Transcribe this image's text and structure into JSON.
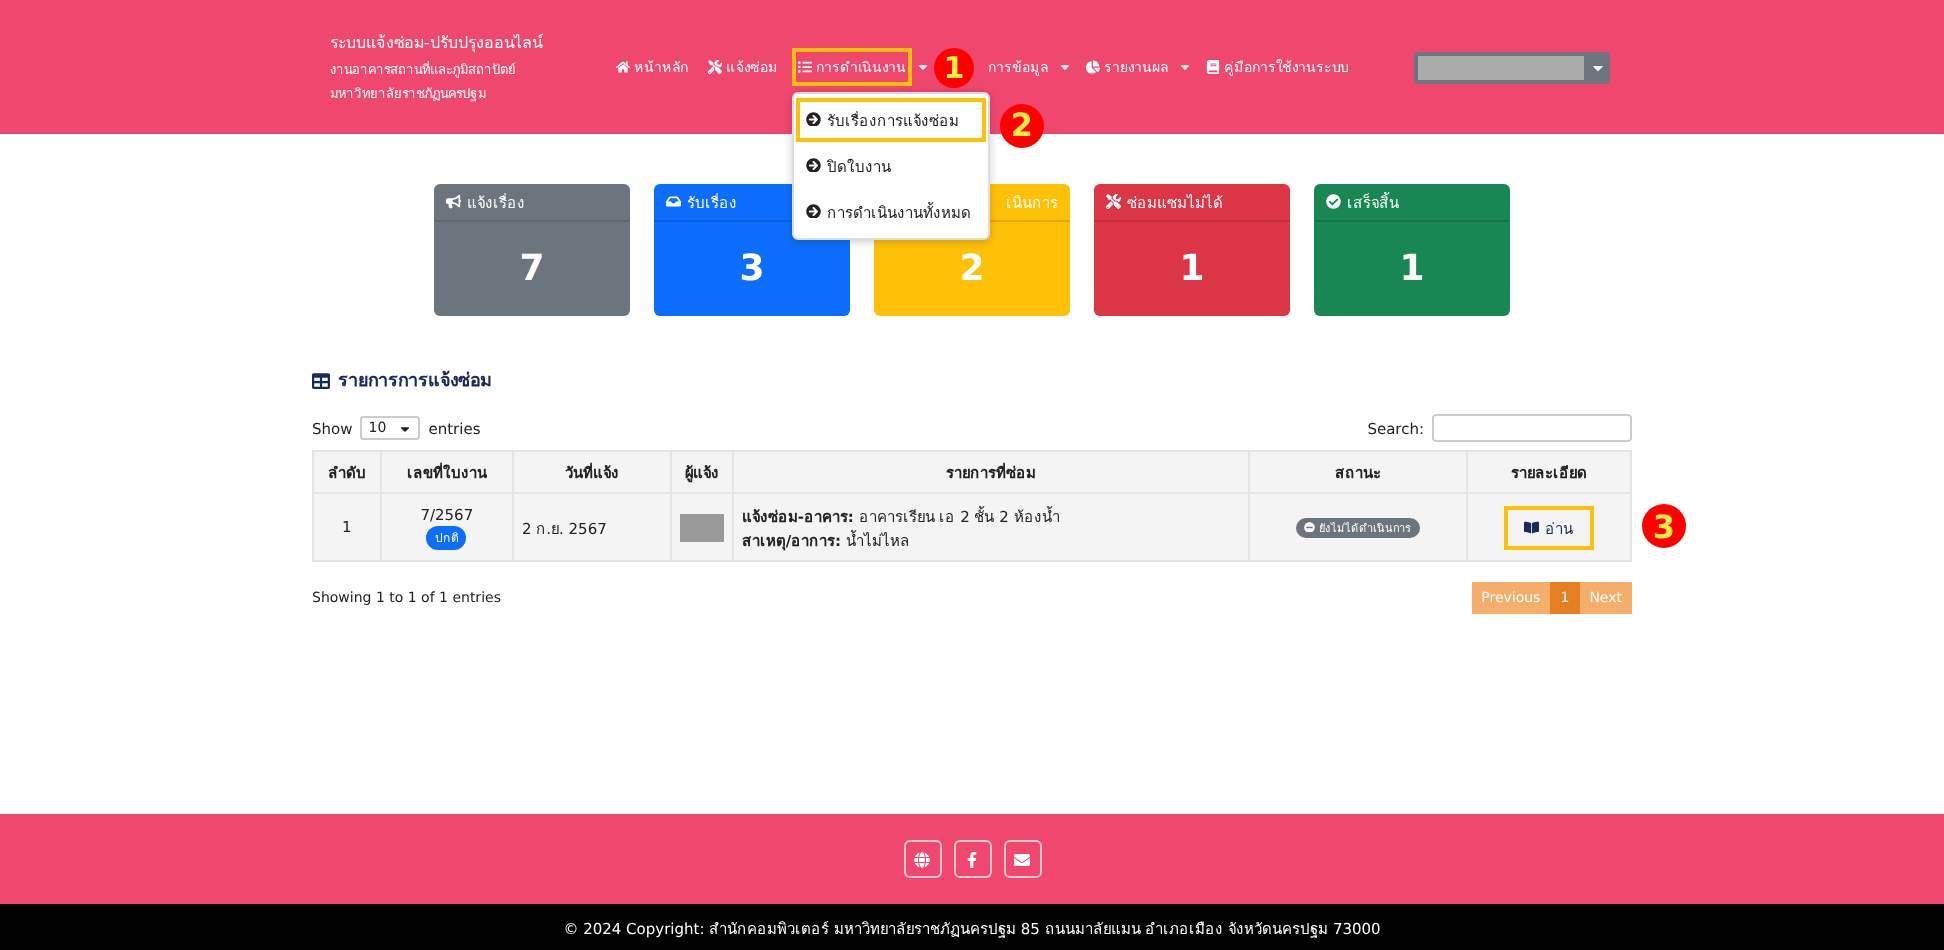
{
  "brand": {
    "title": "ระบบแจ้งซ่อม-ปรับปรุงออนไลน์",
    "subtitle_lines": [
      "งานอาคารสถานที่และภูมิสถาปัตย์",
      "มหาวิทยาลัยราชภัฏนครปฐม"
    ]
  },
  "nav": [
    {
      "label": "หน้าหลัก",
      "caret": false,
      "highlighted": false
    },
    {
      "label": "แจ้งซ่อม",
      "caret": false,
      "highlighted": false
    },
    {
      "label": "การดำเนินงาน",
      "caret": true,
      "highlighted": true
    },
    {
      "label": "การข้อมูล",
      "caret": true,
      "highlighted": false
    },
    {
      "label": "รายงานผล",
      "caret": true,
      "highlighted": false
    },
    {
      "label": "คู่มือการใช้งานระบบ",
      "caret": false,
      "highlighted": false
    }
  ],
  "dropdown": [
    {
      "label": "รับเรื่องการแจ้งซ่อม",
      "highlighted": true
    },
    {
      "label": "ปิดใบงาน",
      "highlighted": false
    },
    {
      "label": "การดำเนินงานทั้งหมด",
      "highlighted": false
    }
  ],
  "markers": [
    "1",
    "2",
    "3"
  ],
  "cards": [
    {
      "title": "แจ้งเรื่อง",
      "count": "7",
      "color": "#6c757d"
    },
    {
      "title": "รับเรื่อง",
      "count": "3",
      "color": "#0d6efd"
    },
    {
      "title": "เนินการ",
      "count": "2",
      "color": "#ffc107"
    },
    {
      "title": "ซ่อมแซมไม่ได้",
      "count": "1",
      "color": "#dc3545"
    },
    {
      "title": "เสร็จสิ้น",
      "count": "1",
      "color": "#198754"
    }
  ],
  "table_section": {
    "title": "รายการการแจ้งซ่อม",
    "show_label": "Show",
    "page_size": "10",
    "entries_label": "entries",
    "search_label": "Search:",
    "columns": [
      "ลำดับ",
      "เลขที่ใบงาน",
      "วันที่แจ้ง",
      "ผู้แจ้ง",
      "รายการที่ซ่อม",
      "สถานะ",
      "รายละเอียด"
    ],
    "rows": [
      {
        "no": "1",
        "job_no": "7/2567",
        "priority": "ปกติ",
        "date": "2 ก.ย. 2567",
        "item": "**แจ้งซ่อม-อาคาร:** อาคารเรียน เอ 2 ชั้น 2 ห้องน้ำ",
        "cause": "**สาเหตุ/อาการ:** น้ำไม่ไหล",
        "status": "ยังไม่ได้ดำเนินการ",
        "action": "อ่าน",
        "action_highlighted": true
      }
    ],
    "info": "Showing 1 to 1 of 1 entries",
    "pagination": [
      {
        "label": "Previous",
        "selected": false
      },
      {
        "label": "1",
        "selected": true
      },
      {
        "label": "Next",
        "selected": false
      }
    ]
  },
  "footer": {
    "copyright": "© 2024 Copyright: สำนักคอมพิวเตอร์ มหาวิทยาลัยราชภัฏนครปฐม 85 ถนนมาลัยแมน อำเภอเมือง จังหวัดนครปฐม 73000"
  }
}
